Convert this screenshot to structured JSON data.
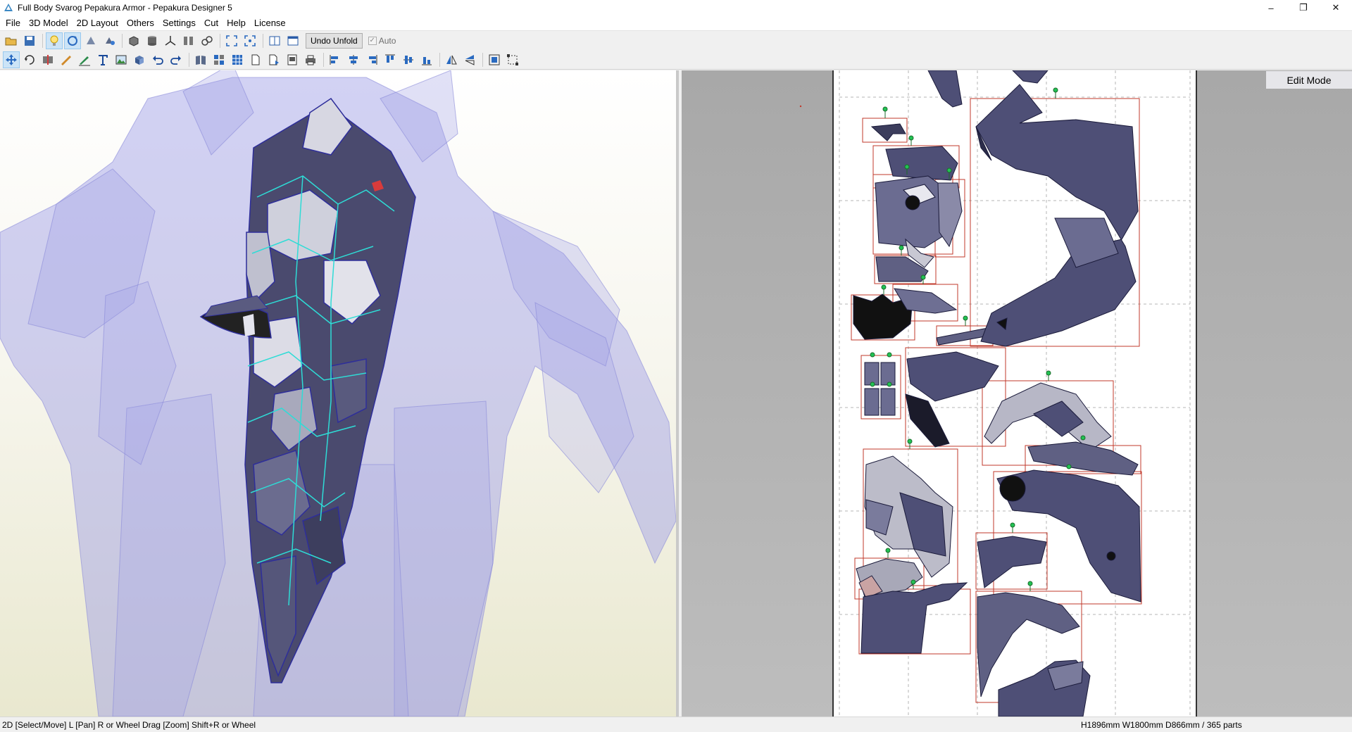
{
  "window": {
    "title": "Full Body Svarog Pepakura Armor - Pepakura Designer 5",
    "controls": [
      "–",
      "❐",
      "✕"
    ]
  },
  "menu": [
    "File",
    "3D Model",
    "2D Layout",
    "Others",
    "Settings",
    "Cut",
    "Help",
    "License"
  ],
  "toolbar1": {
    "icons": [
      "open-icon",
      "save-icon",
      "lightbulb-icon",
      "rotate-3d-icon",
      "rotate-model-icon",
      "pan-model-icon",
      "box-icon",
      "cylinder-icon",
      "axis-icon",
      "split-icon",
      "link-icon",
      "fit-3d-icon",
      "fit-2d-icon",
      "dual-view-icon",
      "single-view-icon"
    ],
    "undo_unfold_label": "Undo Unfold",
    "auto_label": "Auto"
  },
  "toolbar2": {
    "icons": [
      "select-move-icon",
      "rotate-part-icon",
      "join-icon",
      "edit-line-icon",
      "fold-line-icon",
      "text-icon",
      "image-icon",
      "3d-part-icon",
      "undo-icon",
      "redo-icon",
      "book-icon",
      "arrange-icon",
      "grid-icon",
      "page-icon",
      "page-next-icon",
      "print-preview-icon",
      "print-icon",
      "align-left-icon",
      "align-center-icon",
      "align-right-icon",
      "align-top-icon",
      "align-middle-icon",
      "align-bottom-icon",
      "flip-h-icon",
      "flip-v-icon",
      "fit-page-icon",
      "snap-icon"
    ]
  },
  "view2d": {
    "edit_mode_label": "Edit Mode"
  },
  "status": {
    "left": "2D [Select/Move] L [Pan] R or Wheel Drag [Zoom] Shift+R or Wheel",
    "right": "H1896mm W1800mm D866mm / 365 parts"
  },
  "colors": {
    "part_fill": "#4e4f76",
    "part_edge": "#1a1a3a",
    "ghost_model": "#9c9ce6",
    "selection_edge": "#2edcd6",
    "bounding_box": "#c0392b",
    "glue_marker": "#1bb34a"
  }
}
